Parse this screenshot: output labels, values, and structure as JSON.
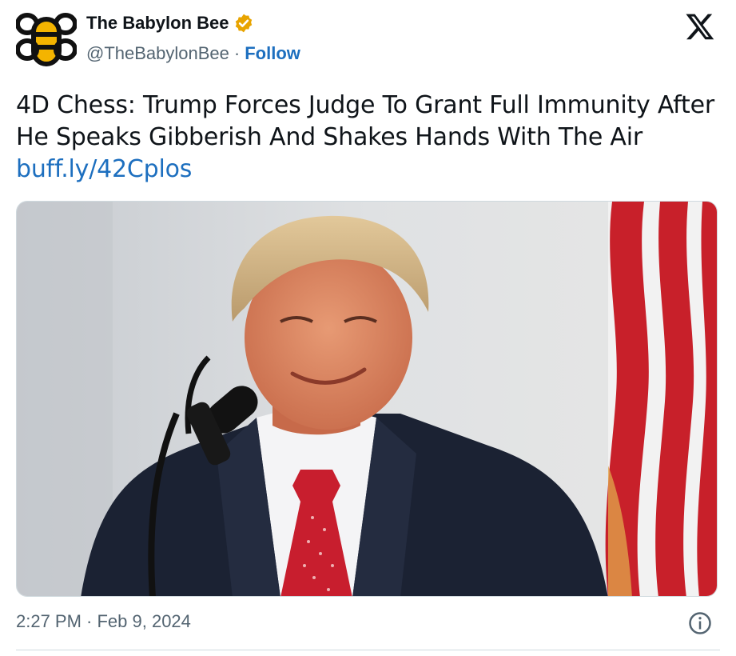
{
  "author": {
    "display_name": "The Babylon Bee",
    "handle": "@TheBabylonBee",
    "separator": "·",
    "follow_label": "Follow",
    "verified_badge_color": "#e8a400",
    "avatar_icon": "bee-logo-icon"
  },
  "tweet": {
    "text": "4D Chess: Trump Forces Judge To Grant Full Immunity After He Speaks Gibberish And Shakes Hands With The Air",
    "link": "buff.ly/42Cplos"
  },
  "meta": {
    "timestamp": "2:27 PM · Feb 9, 2024"
  },
  "colors": {
    "link": "#1d6fbf",
    "muted": "#536471",
    "text": "#0f1419",
    "border": "#cfd9de"
  },
  "icons": {
    "platform": "x-logo-icon",
    "info": "info-icon"
  }
}
